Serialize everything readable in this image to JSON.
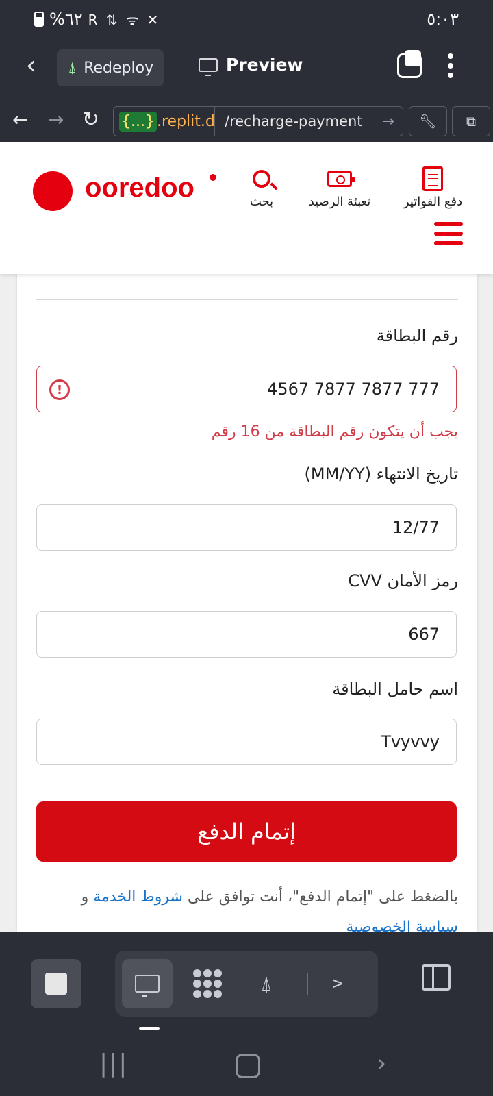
{
  "status_bar": {
    "battery_text": "%٦٢",
    "icons_text": "R ⇅ ᯤ ✕",
    "time": "٥:٠٣"
  },
  "replit_bar": {
    "redeploy_label": "Redeploy",
    "preview_label": "Preview"
  },
  "url_bar": {
    "host_badge": "{...}",
    "host_domain": ".replit.de",
    "path": "/recharge-payment"
  },
  "site_header": {
    "logo_text": "ooredoo",
    "nav": [
      {
        "label": "بحث",
        "icon": "search-icon"
      },
      {
        "label": "تعبئة الرصيد",
        "icon": "topup-icon"
      },
      {
        "label": "دفع الفواتير",
        "icon": "bill-icon"
      }
    ]
  },
  "form": {
    "card_number": {
      "label": "رقم البطاقة",
      "value": "777 7877 7877 4567",
      "error_text": "يجب أن يتكون رقم البطاقة من 16 رقم",
      "error_icon_glyph": "!"
    },
    "expiry": {
      "label": "تاريخ الانتهاء (MM/YY)",
      "value": "12/77"
    },
    "cvv": {
      "label": "رمز الأمان CVV",
      "value": "667"
    },
    "holder": {
      "label": "اسم حامل البطاقة",
      "value": "Tvyvvy"
    },
    "submit_label": "إتمام الدفع",
    "terms_prefix": "بالضغط على \"إتمام الدفع\"، أنت توافق على ",
    "terms_link": "شروط الخدمة",
    "terms_and": " و ",
    "privacy_link": "سياسة الخصوصية"
  },
  "colors": {
    "brand_red": "#e4000f",
    "error_red": "#d23b48",
    "link_blue": "#1a73c8",
    "chrome_dark": "#2b2e36"
  }
}
